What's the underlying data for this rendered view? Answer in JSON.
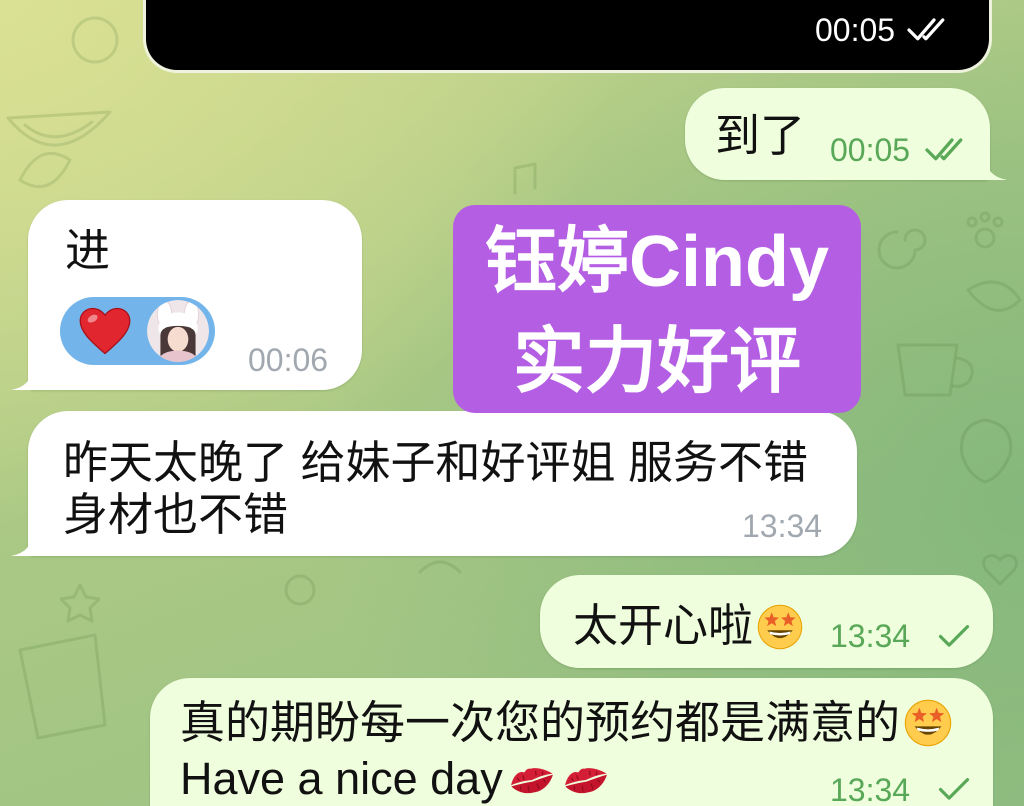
{
  "colors": {
    "outgoing_bubble": "#effedd",
    "incoming_bubble": "#ffffff",
    "outgoing_meta": "#58a858",
    "incoming_meta": "#a1a8b0",
    "label_background": "#b35ee3",
    "reaction_background": "#73b5ea",
    "media_background": "#000000",
    "heart": "#e2262f"
  },
  "media_message": {
    "time": "00:05",
    "status_icon": "double-check-icon"
  },
  "messages": [
    {
      "text": "到了",
      "time": "00:05",
      "status_icon": "double-check-icon"
    },
    {
      "text": "进",
      "time": "00:06",
      "reaction": {
        "emoji": "red-heart-icon",
        "reactor_icon": "avatar"
      }
    },
    {
      "lines": [
        "昨天太晚了 给妹子和好评姐 服务不错",
        "身材也不错"
      ],
      "time": "13:34"
    },
    {
      "text": "太开心啦",
      "emoji": [
        "star-struck-emoji"
      ],
      "time": "13:34",
      "status_icon": "check-icon"
    },
    {
      "lines": [
        {
          "text": "真的期盼每一次您的预约都是满意的",
          "emoji": [
            "star-struck-emoji"
          ]
        },
        {
          "text": "Have a nice day",
          "emoji": [
            "kiss-mark-emoji",
            "kiss-mark-emoji"
          ]
        }
      ],
      "time": "13:34",
      "status_icon": "check-icon"
    }
  ],
  "overlay_label": {
    "lines": [
      "钰婷Cindy",
      "实力好评"
    ]
  }
}
